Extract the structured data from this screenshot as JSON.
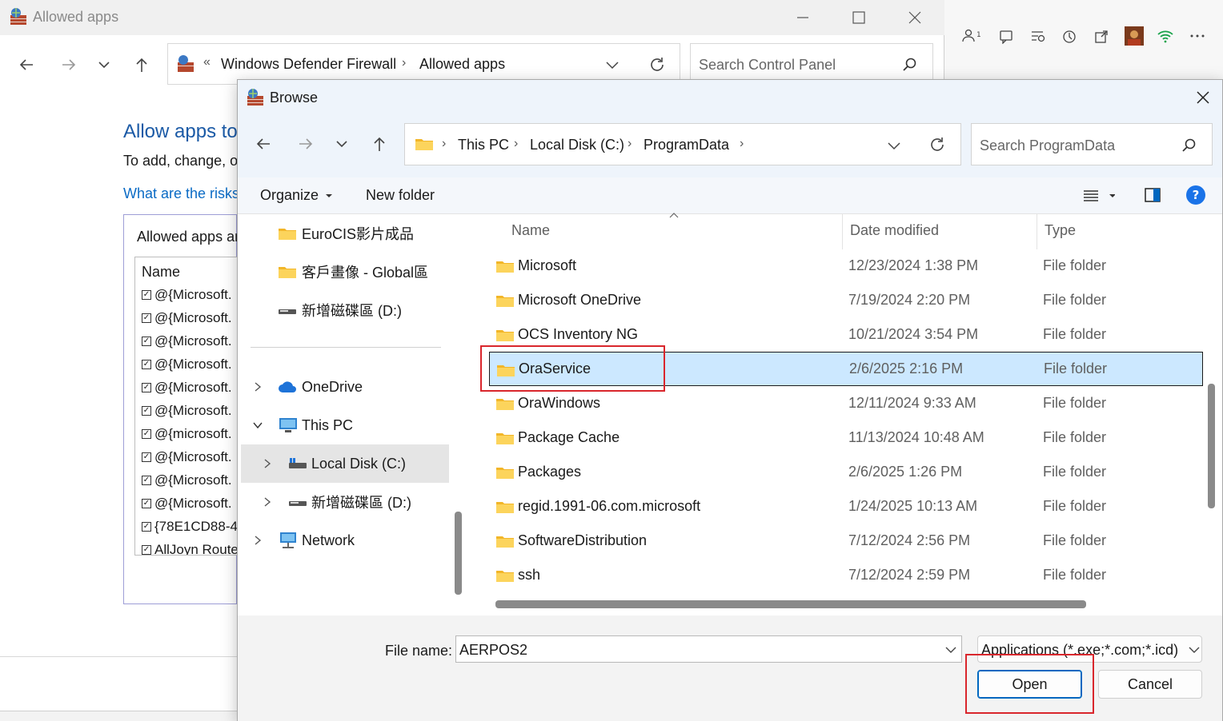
{
  "background_window": {
    "title": "Allowed apps",
    "breadcrumb": [
      "Windows Defender Firewall",
      "Allowed apps"
    ],
    "breadcrumb_prefix": "«",
    "search_placeholder": "Search Control Panel",
    "heading": "Allow apps to",
    "description": "To add, change, or",
    "risk_link": "What are the risks",
    "group_label": "Allowed apps an",
    "list_header": "Name",
    "list_items": [
      "@{Microsoft.",
      "@{Microsoft.",
      "@{Microsoft.",
      "@{Microsoft.",
      "@{Microsoft.",
      "@{Microsoft.",
      "@{microsoft.",
      "@{Microsoft.",
      "@{Microsoft.",
      "@{Microsoft.",
      "{78E1CD88-4",
      "AllJoyn Route"
    ]
  },
  "dialog": {
    "title": "Browse",
    "breadcrumb": [
      "This PC",
      "Local Disk (C:)",
      "ProgramData"
    ],
    "search_placeholder": "Search ProgramData",
    "toolbar": {
      "organize": "Organize",
      "new_folder": "New folder"
    },
    "nav_items": [
      {
        "label": "EuroCIS影片成品",
        "icon": "folder-icon"
      },
      {
        "label": "客戶畫像 - Global區",
        "icon": "folder-icon"
      },
      {
        "label": "新增磁碟區 (D:)",
        "icon": "drive-icon"
      },
      {
        "label": "OneDrive",
        "icon": "cloud-icon"
      },
      {
        "label": "This PC",
        "icon": "pc-icon"
      },
      {
        "label": "Local Disk (C:)",
        "icon": "drive-icon"
      },
      {
        "label": "新增磁碟區 (D:)",
        "icon": "drive-icon"
      },
      {
        "label": "Network",
        "icon": "network-icon"
      }
    ],
    "columns": [
      "Name",
      "Date modified",
      "Type"
    ],
    "files": [
      {
        "name": "Microsoft",
        "date": "12/23/2024 1:38 PM",
        "type": "File folder"
      },
      {
        "name": "Microsoft OneDrive",
        "date": "7/19/2024 2:20 PM",
        "type": "File folder"
      },
      {
        "name": "OCS Inventory NG",
        "date": "10/21/2024 3:54 PM",
        "type": "File folder"
      },
      {
        "name": "OraService",
        "date": "2/6/2025 2:16 PM",
        "type": "File folder"
      },
      {
        "name": "OraWindows",
        "date": "12/11/2024 9:33 AM",
        "type": "File folder"
      },
      {
        "name": "Package Cache",
        "date": "11/13/2024 10:48 AM",
        "type": "File folder"
      },
      {
        "name": "Packages",
        "date": "2/6/2025 1:26 PM",
        "type": "File folder"
      },
      {
        "name": "regid.1991-06.com.microsoft",
        "date": "1/24/2025 10:13 AM",
        "type": "File folder"
      },
      {
        "name": "SoftwareDistribution",
        "date": "7/12/2024 2:56 PM",
        "type": "File folder"
      },
      {
        "name": "ssh",
        "date": "7/12/2024 2:59 PM",
        "type": "File folder"
      }
    ],
    "selected_file": "OraService",
    "file_name_label": "File name:",
    "file_name_value": "AERPOS2",
    "file_type_value": "Applications (*.exe;*.com;*.icd)",
    "open_label": "Open",
    "cancel_label": "Cancel"
  },
  "colors": {
    "selection": "#cce8ff",
    "selection_border": "#0b6bc5",
    "highlight_box": "#d9262c",
    "accent": "#0067c0",
    "link": "#0b6bc5"
  }
}
